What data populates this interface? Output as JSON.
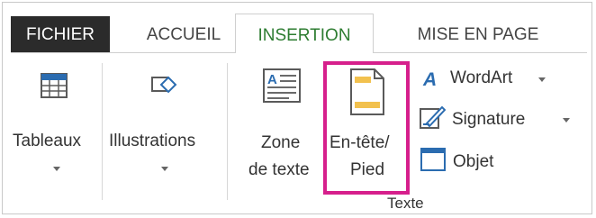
{
  "tabs": {
    "fichier": "FICHIER",
    "accueil": "ACCUEIL",
    "insertion": "INSERTION",
    "mise_en_page": "MISE EN PAGE"
  },
  "ribbon": {
    "tableaux": {
      "label": "Tableaux",
      "icon": "table-icon"
    },
    "illustrations": {
      "label": "Illustrations",
      "icon": "shapes-icon"
    },
    "zone_de_texte": {
      "line1": "Zone",
      "line2": "de texte",
      "icon": "text-box-icon"
    },
    "entete_pied": {
      "line1": "En-tête/",
      "line2": "Pied",
      "icon": "header-footer-icon"
    },
    "wordart": {
      "label": "WordArt",
      "icon": "wordart-icon"
    },
    "signature": {
      "label": "Signature",
      "icon": "signature-line-icon"
    },
    "objet": {
      "label": "Objet",
      "icon": "object-icon"
    },
    "group_texte": "Texte"
  },
  "colors": {
    "active_tab_text": "#2e7d32",
    "fichier_tab_bg": "#2b2b2b",
    "highlight": "#d61f8c",
    "icon_blue": "#2b6cb0",
    "doc_yellow": "#f2c14e"
  }
}
